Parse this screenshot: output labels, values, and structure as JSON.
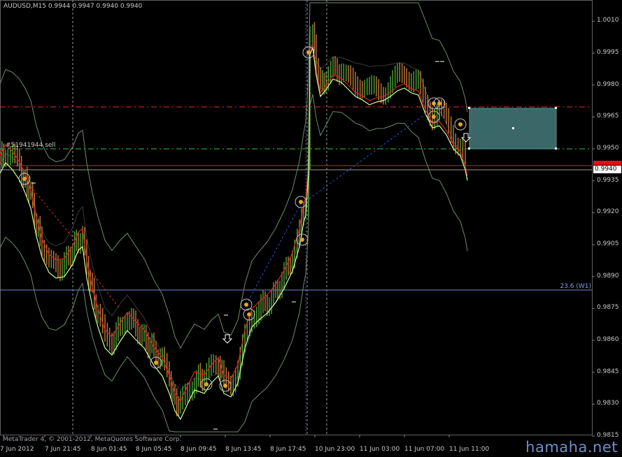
{
  "window": {
    "title": "AUDUSD,M15  0.9944 0.9947 0.9940 0.9940",
    "copyright": "MetaTrader 4, © 2001-2012, MetaQuotes Software Corp.",
    "watermark": "hamaha.net"
  },
  "annotations": {
    "order_label": "#51941944 sell",
    "fib_label": "23.6 (W1)",
    "current_price": "0.9940"
  },
  "colors": {
    "background": "#000000",
    "bull_candle": "#4fa33a",
    "bear_candle": "#c07a3a",
    "fast_ma": "#ccff99",
    "slow_ma": "#e02020",
    "bands": "#6e8a6e",
    "order_line": "#40c040",
    "stop_line": "#e03030",
    "fib_line": "#6a8ad8",
    "rectangle": "#3a6868"
  },
  "y_axis": {
    "ticks": [
      "1.0010",
      "0.9995",
      "0.9980",
      "0.9965",
      "0.9950",
      "0.9935",
      "0.9920",
      "0.9905",
      "0.9890",
      "0.9875",
      "0.9860",
      "0.9845",
      "0.9830",
      "0.9815"
    ]
  },
  "x_axis": {
    "ticks": [
      "7 Jun 2012",
      "7 Jun 21:45",
      "8 Jun 01:45",
      "8 Jun 05:45",
      "8 Jun 09:45",
      "8 Jun 13:45",
      "8 Jun 17:45",
      "10 Jun 23:00",
      "11 Jun 03:00",
      "11 Jun 07:00",
      "11 Jun 11:00"
    ]
  },
  "chart_data": {
    "type": "line",
    "x": [
      "7 Jun 2012",
      "7 Jun 21:45",
      "8 Jun 01:45",
      "8 Jun 05:45",
      "8 Jun 09:45",
      "8 Jun 13:45",
      "8 Jun 17:45",
      "10 Jun 23:00",
      "11 Jun 03:00",
      "11 Jun 07:00",
      "11 Jun 11:00"
    ],
    "series": [
      {
        "name": "AUDUSD",
        "values": [
          0.9945,
          0.99,
          0.9865,
          0.985,
          0.9838,
          0.987,
          0.992,
          0.999,
          0.9983,
          0.9968,
          0.994
        ]
      }
    ],
    "ylim": [
      0.9808,
      1.002
    ]
  }
}
